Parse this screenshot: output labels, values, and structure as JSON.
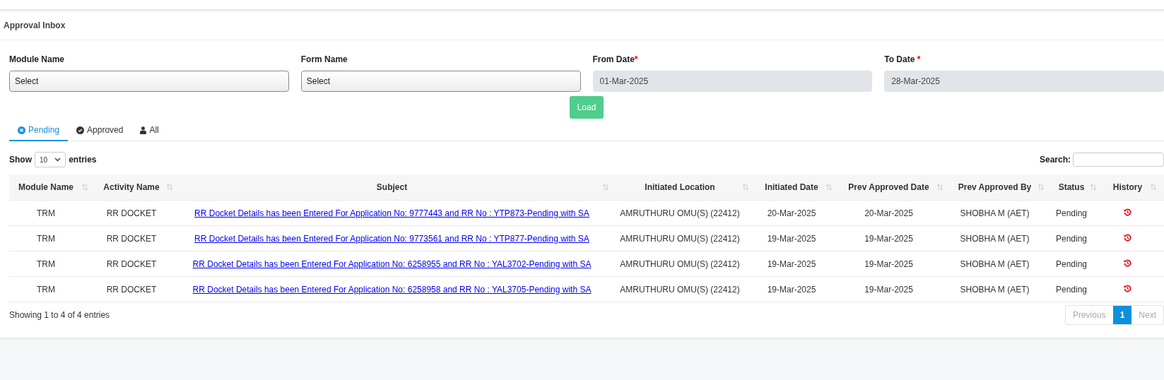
{
  "page": {
    "title": "Approval Inbox"
  },
  "filters": [
    {
      "label": "Module Name",
      "kind": "select",
      "value": "Select"
    },
    {
      "label": "Form Name",
      "kind": "select",
      "value": "Select"
    },
    {
      "label": "From Date",
      "kind": "date",
      "value": "01-Mar-2025",
      "required_mark": "*"
    },
    {
      "label": "To Date",
      "kind": "date",
      "value": "28-Mar-2025",
      "required_mark": " *"
    }
  ],
  "load_button": "Load",
  "tabs": [
    {
      "label": "Pending",
      "kind": "pending",
      "selected": true
    },
    {
      "label": "Approved",
      "kind": "approved",
      "selected": false
    },
    {
      "label": "All",
      "kind": "all",
      "selected": false
    }
  ],
  "entries": {
    "prefix": "Show",
    "value": "10",
    "suffix": "entries"
  },
  "search": {
    "label": "Search:"
  },
  "table": {
    "columns": [
      {
        "label": "Module Name",
        "kind": "text"
      },
      {
        "label": "Activity Name",
        "kind": "text"
      },
      {
        "label": "Subject",
        "kind": "link"
      },
      {
        "label": "Initiated Location",
        "kind": "text"
      },
      {
        "label": "Initiated Date",
        "kind": "text"
      },
      {
        "label": "Prev Approved Date",
        "kind": "text"
      },
      {
        "label": "Prev Approved By",
        "kind": "text"
      },
      {
        "label": "Status",
        "kind": "text"
      },
      {
        "label": "History",
        "kind": "icon"
      }
    ],
    "rows": [
      {
        "cells": [
          "TRM",
          "RR DOCKET",
          "RR Docket Details has been Entered For Application No: 9777443 and RR No : YTP873-Pending with SA",
          "AMRUTHURU OMU(S) (22412)",
          "20-Mar-2025",
          "20-Mar-2025",
          "SHOBHA M (AET)",
          "Pending"
        ]
      },
      {
        "cells": [
          "TRM",
          "RR DOCKET",
          "RR Docket Details has been Entered For Application No: 9773561 and RR No : YTP877-Pending with SA",
          "AMRUTHURU OMU(S) (22412)",
          "19-Mar-2025",
          "19-Mar-2025",
          "SHOBHA M (AET)",
          "Pending"
        ]
      },
      {
        "cells": [
          "TRM",
          "RR DOCKET",
          "RR Docket Details has been Entered For Application No: 6258955 and RR No : YAL3702-Pending with SA",
          "AMRUTHURU OMU(S) (22412)",
          "19-Mar-2025",
          "19-Mar-2025",
          "SHOBHA M (AET)",
          "Pending"
        ]
      },
      {
        "cells": [
          "TRM",
          "RR DOCKET",
          "RR Docket Details has been Entered For Application No: 6258958 and RR No : YAL3705-Pending with SA",
          "AMRUTHURU OMU(S) (22412)",
          "19-Mar-2025",
          "19-Mar-2025",
          "SHOBHA M (AET)",
          "Pending"
        ]
      }
    ]
  },
  "footer": {
    "info": "Showing 1 to 4 of 4 entries"
  },
  "pagination": [
    {
      "label": "Previous",
      "disabled": true,
      "selected": false
    },
    {
      "label": "1",
      "disabled": false,
      "selected": true
    },
    {
      "label": "Next",
      "disabled": true,
      "selected": false
    }
  ]
}
